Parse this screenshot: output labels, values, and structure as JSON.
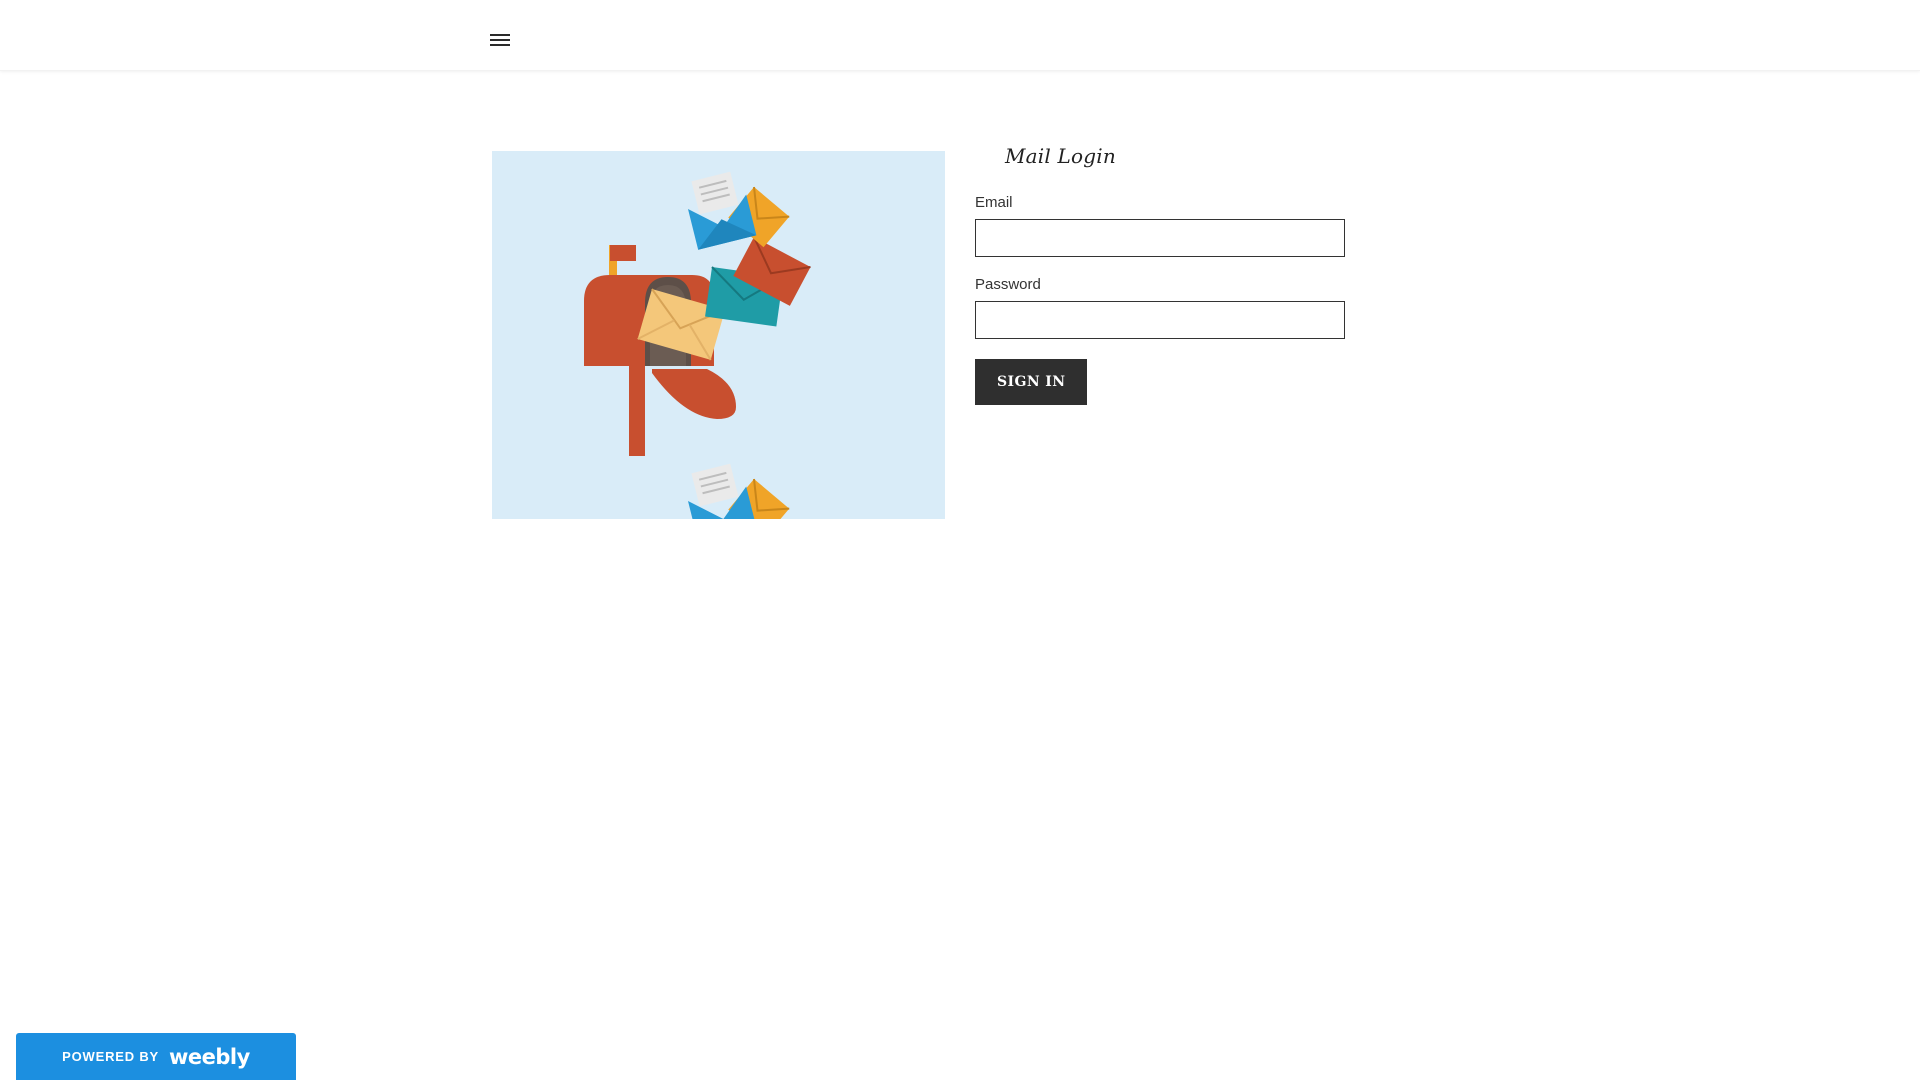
{
  "header": {
    "menu_icon": "hamburger-menu-icon"
  },
  "hero": {
    "illustration": "mailbox-with-envelopes-illustration"
  },
  "login": {
    "title": "Mail Login",
    "email_label": "Email",
    "email_value": "",
    "password_label": "Password",
    "password_value": "",
    "submit_label": "SIGN IN"
  },
  "footer": {
    "powered_by": "POWERED BY",
    "brand": "weebly"
  },
  "colors": {
    "badge_background": "#1c8fe0",
    "button_background": "#2f2f2f",
    "image_background": "#d9ecf8"
  }
}
